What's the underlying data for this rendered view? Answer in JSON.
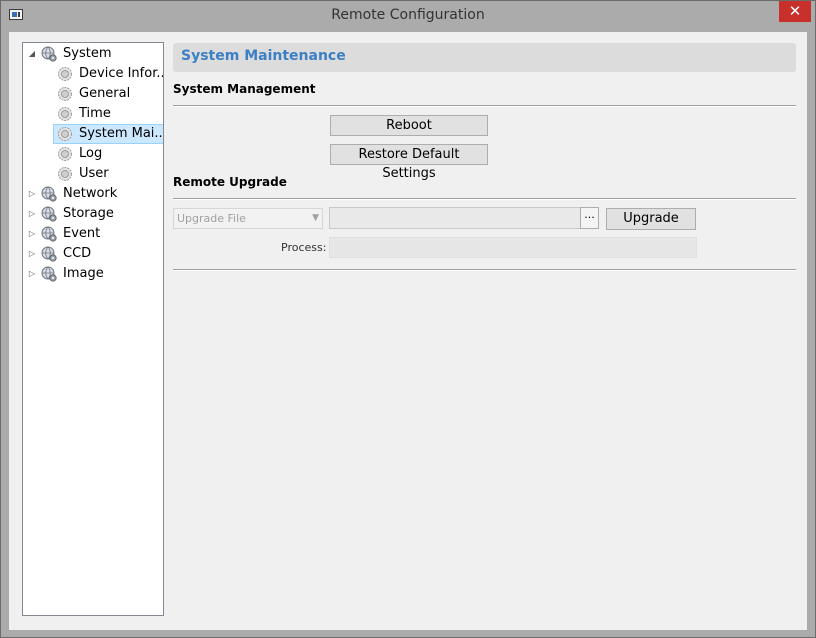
{
  "window": {
    "title": "Remote Configuration",
    "close_label": "✕"
  },
  "tree": {
    "items": [
      {
        "label": "System",
        "expanded": true,
        "icon": "globe-gear-icon"
      },
      {
        "label": "Device Infor...",
        "icon": "gear-icon"
      },
      {
        "label": "General",
        "icon": "gear-icon"
      },
      {
        "label": "Time",
        "icon": "gear-icon"
      },
      {
        "label": "System Mai...",
        "icon": "gear-icon",
        "selected": true
      },
      {
        "label": "Log",
        "icon": "gear-icon"
      },
      {
        "label": "User",
        "icon": "gear-icon"
      },
      {
        "label": "Network",
        "expanded": false,
        "icon": "globe-gear-icon"
      },
      {
        "label": "Storage",
        "expanded": false,
        "icon": "globe-gear-icon"
      },
      {
        "label": "Event",
        "expanded": false,
        "icon": "globe-gear-icon"
      },
      {
        "label": "CCD",
        "expanded": false,
        "icon": "globe-gear-icon"
      },
      {
        "label": "Image",
        "expanded": false,
        "icon": "globe-gear-icon"
      }
    ]
  },
  "panel": {
    "title": "System Maintenance",
    "title_color": "#3b7fc4",
    "management": {
      "heading": "System Management",
      "reboot_label": "Reboot",
      "restore_label": "Restore Default Settings"
    },
    "upgrade": {
      "heading": "Remote Upgrade",
      "file_type_value": "Upgrade File",
      "file_path_value": "",
      "browse_label": "...",
      "upgrade_label": "Upgrade",
      "process_label": "Process:",
      "process_progress": 0
    }
  }
}
